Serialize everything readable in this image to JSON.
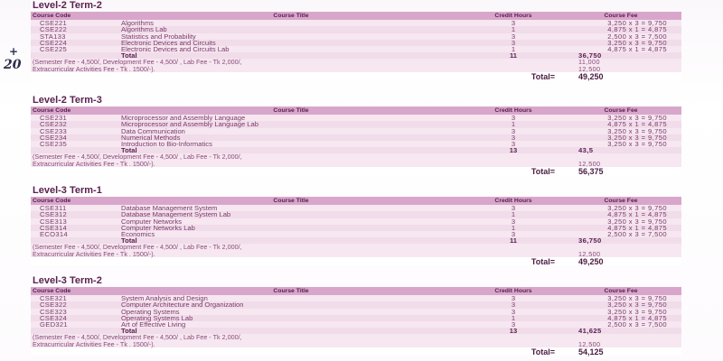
{
  "headers": {
    "code": "Course Code",
    "title": "Course Title",
    "hours": "Credit Hours",
    "fee": "Course Fee"
  },
  "sections": [
    {
      "title": "Level-2 Term-2",
      "courses": [
        {
          "code": "CSE221",
          "title": "Algorithms",
          "hours": "3",
          "fee": "3,250 x 3 = 9,750"
        },
        {
          "code": "CSE222",
          "title": "Algorithms Lab",
          "hours": "1",
          "fee": "4,875 x 1 = 4,875"
        },
        {
          "code": "STA133",
          "title": "Statistics and Probability",
          "hours": "3",
          "fee": "2,500 x 3 = 7,500"
        },
        {
          "code": "CSE224",
          "title": "Electronic Devices and Circuits",
          "hours": "3",
          "fee": "3,250 x 3 = 9,750"
        },
        {
          "code": "CSE225",
          "title": "Electronic Devices and Circuits Lab",
          "hours": "1",
          "fee": "4,875 x 1 = 4,875"
        }
      ],
      "total_label": "Total",
      "total_hours": "11",
      "total_fee": "36,750",
      "fee_note": "(Semester Fee - 4,500/, Development Fee - 4,500/ , Lab Fee - Tk 2,000/,",
      "fee_note_value": "11,000",
      "extra_note": "Extracurricular Activities Fee - Tk . 1500/-).",
      "extra_value": "12,500",
      "grand_label": "Total=",
      "grand_total": "49,250"
    },
    {
      "title": "Level-2 Term-3",
      "courses": [
        {
          "code": "CSE231",
          "title": "Microprocessor and Assembly Language",
          "hours": "3",
          "fee": "3,250 x 3 = 9,750"
        },
        {
          "code": "CSE232",
          "title": "Microprocessor and Assembly Language Lab",
          "hours": "1",
          "fee": "4,875 x 1 = 4,875"
        },
        {
          "code": "CSE233",
          "title": "Data Communication",
          "hours": "3",
          "fee": "3,250 x 3 = 9,750"
        },
        {
          "code": "CSE234",
          "title": "Numerical Methods",
          "hours": "3",
          "fee": "3,250 x 3 = 9,750"
        },
        {
          "code": "CSE235",
          "title": "Introduction to Bio-Informatics",
          "hours": "3",
          "fee": "3,250 x 3 = 9,750"
        }
      ],
      "total_label": "Total",
      "total_hours": "13",
      "total_fee": "43,5",
      "fee_note": "(Semester Fee - 4,500/, Development Fee - 4,500/ , Lab Fee - Tk 2,000/,",
      "fee_note_value": "",
      "extra_note": "Extracurricular Activities Fee - Tk . 1500/-).",
      "extra_value": "12,500",
      "grand_label": "Total=",
      "grand_total": "56,375"
    },
    {
      "title": "Level-3 Term-1",
      "courses": [
        {
          "code": "CSE311",
          "title": "Database Management System",
          "hours": "3",
          "fee": "3,250 x 3 = 9,750"
        },
        {
          "code": "CSE312",
          "title": "Database Management System Lab",
          "hours": "1",
          "fee": "4,875 x 1 = 4,875"
        },
        {
          "code": "CSE313",
          "title": "Computer Networks",
          "hours": "3",
          "fee": "3,250 x 3 = 9,750"
        },
        {
          "code": "CSE314",
          "title": "Computer Networks Lab",
          "hours": "1",
          "fee": "4,875 x 1 = 4,875"
        },
        {
          "code": "ECO314",
          "title": "Economics",
          "hours": "3",
          "fee": "2,500 x 3 = 7,500"
        }
      ],
      "total_label": "Total",
      "total_hours": "11",
      "total_fee": "36,750",
      "fee_note": "(Semester Fee - 4,500/, Development Fee - 4,500/ , Lab Fee - Tk 2,000/,",
      "fee_note_value": "",
      "extra_note": "Extracurricular Activities Fee - Tk . 1500/-).",
      "extra_value": "12,500",
      "grand_label": "Total=",
      "grand_total": "49,250"
    },
    {
      "title": "Level-3 Term-2",
      "courses": [
        {
          "code": "CSE321",
          "title": "System Analysis and Design",
          "hours": "3",
          "fee": "3,250 x 3 = 9,750"
        },
        {
          "code": "CSE322",
          "title": "Computer Architecture and Organization",
          "hours": "3",
          "fee": "3,250 x 3 = 9,750"
        },
        {
          "code": "CSE323",
          "title": "Operating Systems",
          "hours": "3",
          "fee": "3,250 x 3 = 9,750"
        },
        {
          "code": "CSE324",
          "title": "Operating Systems Lab",
          "hours": "1",
          "fee": "4,875 x 1 = 4,875"
        },
        {
          "code": "GED321",
          "title": "Art of Effective Living",
          "hours": "3",
          "fee": "2,500 x 3 = 7,500"
        }
      ],
      "total_label": "Total",
      "total_hours": "13",
      "total_fee": "41,625",
      "fee_note": "(Semester Fee - 4,500/, Development Fee - 4,500/ , Lab Fee - Tk 2,000/,",
      "fee_note_value": "",
      "extra_note": "Extracurricular Activities Fee - Tk . 1500/-).",
      "extra_value": "12,500",
      "grand_label": "Total=",
      "grand_total": "54,125"
    }
  ],
  "handwriting": {
    "mark_top": "+",
    "mark_bottom": "20"
  }
}
